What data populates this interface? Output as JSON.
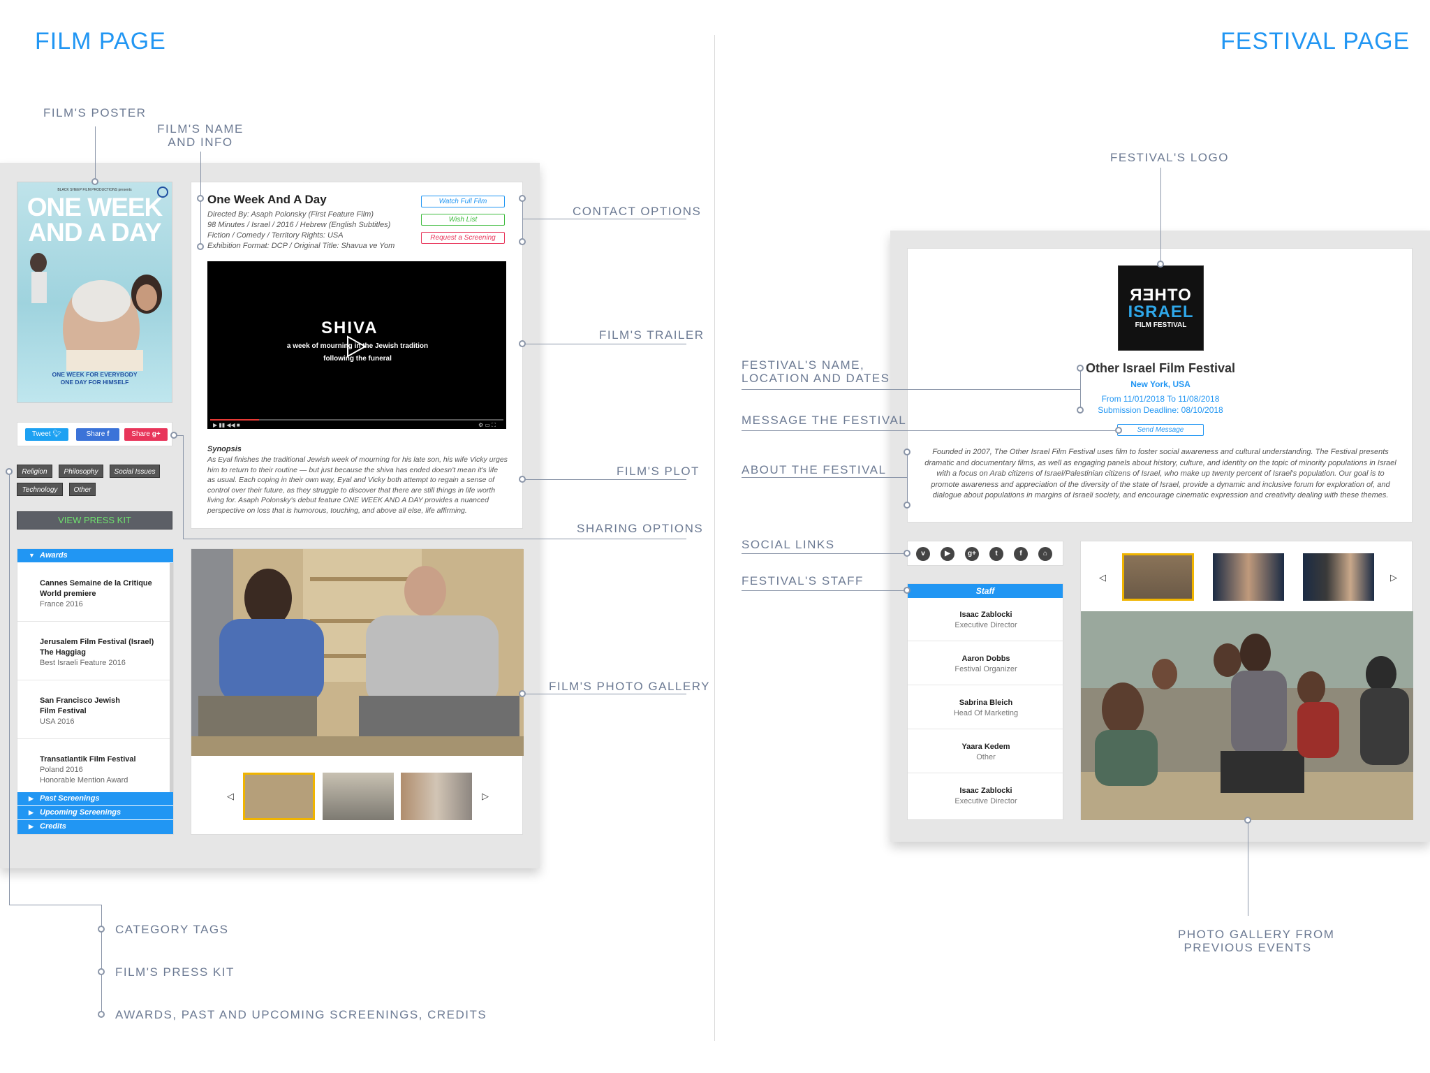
{
  "film_page": {
    "title": "FILM PAGE",
    "annotations": {
      "poster": "FILM'S POSTER",
      "name_info_1": "FILM'S NAME",
      "name_info_2": "AND INFO",
      "contact": "CONTACT OPTIONS",
      "trailer": "FILM'S TRAILER",
      "plot": "FILM'S PLOT",
      "sharing": "SHARING OPTIONS",
      "gallery": "FILM'S PHOTO GALLERY",
      "tags": "CATEGORY TAGS",
      "press_kit": "FILM'S PRESS KIT",
      "awards": "AWARDS, PAST AND UPCOMING SCREENINGS, CREDITS"
    },
    "poster": {
      "top_text": "BLACK SHEEP FILM PRODUCTIONS presents",
      "title_1": "ONE WEEK",
      "title_2": "AND A DAY",
      "tagline_1": "ONE WEEK FOR EVERYBODY",
      "tagline_2": "ONE DAY FOR HIMSELF"
    },
    "film": {
      "name": "One Week And A Day",
      "info": [
        "Directed By: Asaph Polonsky (First Feature Film)",
        "98 Minutes / Israel / 2016 / Hebrew (English Subtitles)",
        "Fiction / Comedy / Territory Rights: USA",
        "Exhibition Format: DCP / Original Title: Shavua ve Yom"
      ]
    },
    "contact_buttons": {
      "watch": "Watch Full Film",
      "wishlist": "Wish List",
      "screening": "Request a Screening"
    },
    "trailer": {
      "title": "SHIVA",
      "sub_1": "a week of  mourning in the Jewish tradition",
      "sub_2": "following the funeral"
    },
    "synopsis": {
      "heading": "Synopsis",
      "text": "As Eyal finishes the traditional Jewish week of mourning for his late son, his wife Vicky urges him to return to their routine — but just because the shiva has ended doesn't mean it's life as usual. Each coping in their own way, Eyal and Vicky both attempt to regain a sense of control over their future, as they struggle to discover that there are still things in life worth living for. Asaph Polonsky's debut feature ONE WEEK AND A DAY provides a nuanced perspective on loss that is humorous, touching, and above all else, life affirming."
    },
    "share": {
      "tweet": "Tweet",
      "share_fb": "Share",
      "share_gplus": "Share"
    },
    "tags": [
      "Religion",
      "Philosophy",
      "Social Issues",
      "Technology",
      "Other"
    ],
    "press_kit_label": "VIEW PRESS KIT",
    "accordion": {
      "awards_label": "Awards",
      "awards": [
        {
          "title_1": "Cannes Semaine de la Critique",
          "title_2": "World premiere",
          "sub_1": "France 2016",
          "sub_2": ""
        },
        {
          "title_1": "Jerusalem Film Festival (Israel)",
          "title_2": "The Haggiag",
          "sub_1": "Best Israeli Feature 2016",
          "sub_2": ""
        },
        {
          "title_1": "San Francisco Jewish",
          "title_2": "Film Festival",
          "sub_1": "USA 2016",
          "sub_2": ""
        },
        {
          "title_1": "Transatlantik Film Festival",
          "title_2": "",
          "sub_1": "Poland 2016",
          "sub_2": "Honorable Mention Award"
        }
      ],
      "past_label": "Past Screenings",
      "upcoming_label": "Upcoming Screenings",
      "credits_label": "Credits"
    }
  },
  "festival_page": {
    "title": "FESTIVAL PAGE",
    "annotations": {
      "logo": "FESTIVAL'S LOGO",
      "name_1": "FESTIVAL'S NAME,",
      "name_2": "LOCATION AND DATES",
      "message": "MESSAGE THE FESTIVAL",
      "about": "ABOUT THE FESTIVAL",
      "social": "SOCIAL LINKS",
      "staff": "FESTIVAL'S STAFF",
      "gallery_1": "PHOTO GALLERY FROM",
      "gallery_2": "PREVIOUS EVENTS"
    },
    "logo": {
      "line1": "ЯƎHTO",
      "line2": "ISRAEL",
      "line3": "FILM FESTIVAL"
    },
    "festival": {
      "name": "Other Israel Film Festival",
      "location": "New York, USA",
      "dates": "From 11/01/2018 To 11/08/2018",
      "deadline": "Submission Deadline: 08/10/2018"
    },
    "send_message": "Send Message",
    "about": "Founded in 2007, The Other Israel Film Festival uses film to foster social awareness and cultural understanding. The Festival presents dramatic and documentary films, as well as engaging panels about history, culture, and identity on the topic of minority populations in Israel with a focus on Arab citizens of Israel/Palestinian citizens of Israel, who make up twenty percent of Israel's population. Our goal is to promote awareness and appreciation of the diversity of the state of Israel, provide a dynamic and inclusive forum for exploration of, and dialogue about populations in margins of Israeli society, and encourage cinematic expression and creativity dealing with these themes.",
    "social_icons": [
      "vimeo-icon",
      "youtube-icon",
      "google-plus-icon",
      "twitter-icon",
      "facebook-icon",
      "home-icon"
    ],
    "staff_label": "Staff",
    "staff": [
      {
        "name": "Isaac Zablocki",
        "role": "Executive Director"
      },
      {
        "name": "Aaron Dobbs",
        "role": "Festival Organizer"
      },
      {
        "name": "Sabrina Bleich",
        "role": "Head Of Marketing"
      },
      {
        "name": "Yaara Kedem",
        "role": "Other"
      },
      {
        "name": "Isaac Zablocki",
        "role": "Executive Director"
      }
    ]
  },
  "colors": {
    "accent": "#2196f3",
    "annotation": "#6c7a93",
    "tweet": "#1da1f2",
    "facebook": "#3b73d8",
    "gplus": "#e8355a",
    "press_kit_text": "#6fe26f",
    "selected_thumb": "#f0b400"
  }
}
